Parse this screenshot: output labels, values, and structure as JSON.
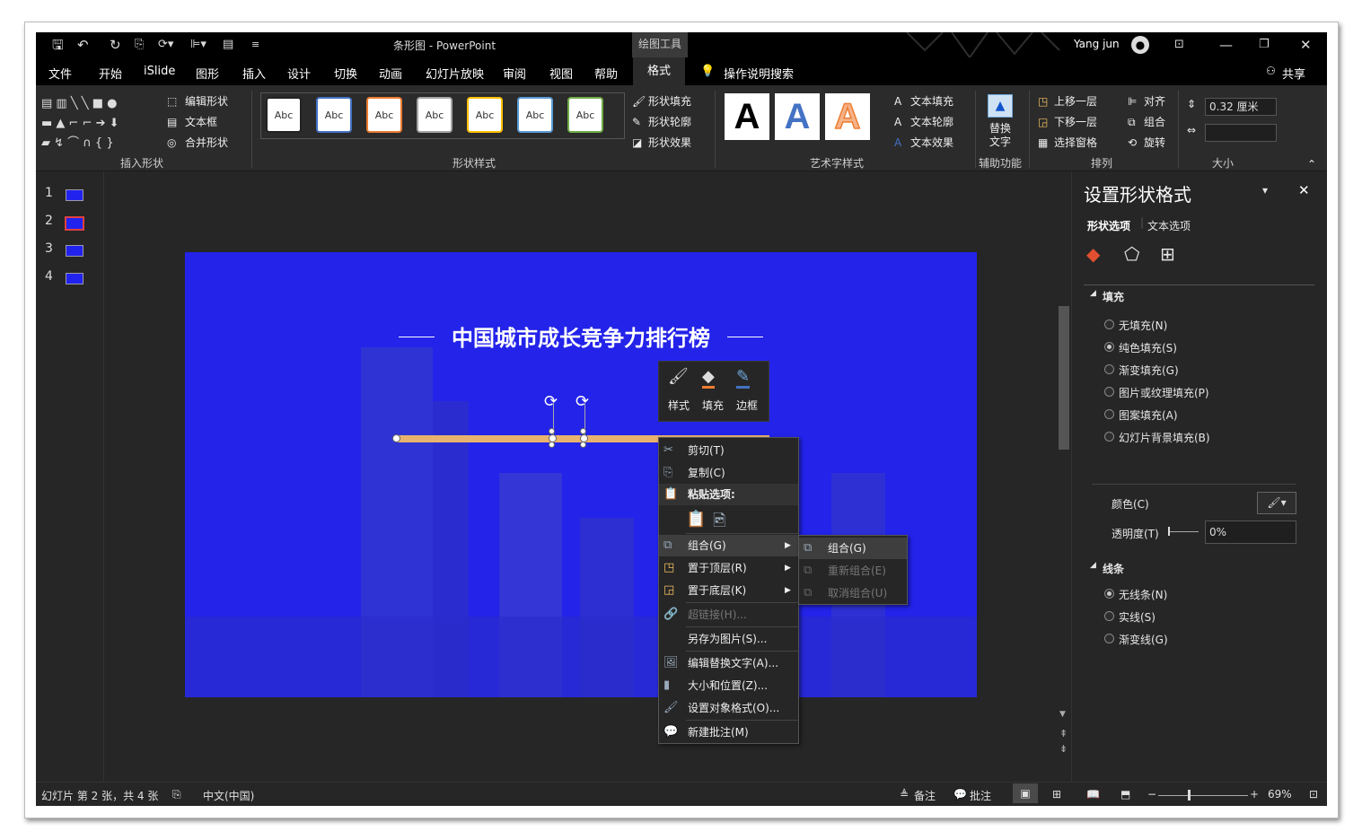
{
  "titlebar": {
    "doc_title": "条形图 - PowerPoint",
    "context_tab_group": "绘图工具",
    "user": "Yang jun",
    "icons": [
      "save-icon",
      "undo-icon",
      "redo-icon",
      "present-icon",
      "format-painter-icon",
      "align-icon",
      "textbox-icon",
      "customize-icon"
    ]
  },
  "menu": {
    "tabs": [
      "文件",
      "开始",
      "iSlide",
      "图形",
      "插入",
      "设计",
      "切换",
      "动画",
      "幻灯片放映",
      "审阅",
      "视图",
      "帮助"
    ],
    "active_tab": "格式",
    "tell_me": "操作说明搜索",
    "share": "共享"
  },
  "ribbon": {
    "insert_shapes": {
      "edit_shape": "编辑形状",
      "text_box": "文本框",
      "merge_shapes": "合并形状",
      "label": "插入形状"
    },
    "shape_styles": {
      "preset_label": "Abc",
      "fill": "形状填充",
      "outline": "形状轮廓",
      "effects": "形状效果",
      "label": "形状样式",
      "preset_colors": [
        "#222222",
        "#4472c4",
        "#ed7d31",
        "#a5a5a5",
        "#ffc000",
        "#5b9bd5",
        "#70ad47"
      ]
    },
    "wordart": {
      "glyph": "A",
      "text_fill": "文本填充",
      "text_outline": "文本轮廓",
      "text_effects": "文本效果",
      "label": "艺术字样式"
    },
    "accessibility": {
      "alt_text_line1": "替换",
      "alt_text_line2": "文字",
      "label": "辅助功能"
    },
    "arrange": {
      "bring_forward": "上移一层",
      "send_backward": "下移一层",
      "selection_pane": "选择窗格",
      "align": "对齐",
      "group": "组合",
      "rotate": "旋转",
      "label": "排列"
    },
    "size": {
      "height": "0.32 厘米",
      "width": "",
      "label": "大小"
    }
  },
  "thumbnails": {
    "numbers": [
      "1",
      "2",
      "3",
      "4"
    ],
    "selected": "2"
  },
  "slide": {
    "title": "中国城市成长竞争力排行榜",
    "accent": "#2323ea",
    "bar_color": "#e8b36e"
  },
  "mini_toolbar": {
    "style": "样式",
    "fill": "填充",
    "border": "边框"
  },
  "context_menu": {
    "cut": "剪切(T)",
    "copy": "复制(C)",
    "paste_options": "粘贴选项:",
    "group": "组合(G)",
    "bring_to_front": "置于顶层(R)",
    "send_to_back": "置于底层(K)",
    "hyperlink": "超链接(H)...",
    "save_as_picture": "另存为图片(S)...",
    "edit_alt_text": "编辑替换文字(A)...",
    "size_position": "大小和位置(Z)...",
    "format_object": "设置对象格式(O)...",
    "new_comment": "新建批注(M)"
  },
  "group_submenu": {
    "group": "组合(G)",
    "regroup": "重新组合(E)",
    "ungroup": "取消组合(U)"
  },
  "format_pane": {
    "title": "设置形状格式",
    "tab_shape": "形状选项",
    "tab_text": "文本选项",
    "fill_section": "填充",
    "fill_options": [
      "无填充(N)",
      "纯色填充(S)",
      "渐变填充(G)",
      "图片或纹理填充(P)",
      "图案填充(A)",
      "幻灯片背景填充(B)"
    ],
    "fill_selected": "纯色填充(S)",
    "color_label": "颜色(C)",
    "transparency_label": "透明度(T)",
    "transparency_value": "0%",
    "line_section": "线条",
    "line_options": [
      "无线条(N)",
      "实线(S)",
      "渐变线(G)"
    ],
    "line_selected": "无线条(N)"
  },
  "statusbar": {
    "slide_info": "幻灯片 第 2 张，共 4 张",
    "language": "中文(中国)",
    "notes": "备注",
    "comments": "批注",
    "zoom": "69%",
    "zoom_fraction": 0.69
  }
}
